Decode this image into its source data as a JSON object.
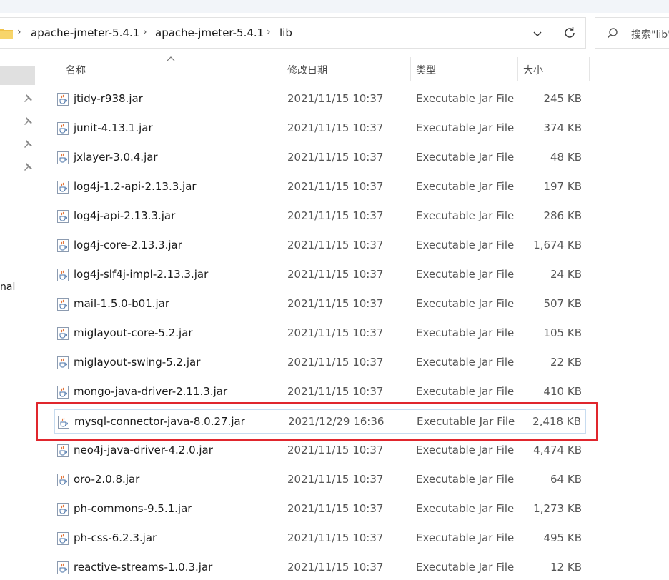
{
  "breadcrumb": {
    "items": [
      "apache-jmeter-5.4.1",
      "apache-jmeter-5.4.1",
      "lib"
    ]
  },
  "search": {
    "placeholder": "搜索\"lib\""
  },
  "nav": {
    "partial_label": "nal"
  },
  "columns": {
    "name": "名称",
    "modified": "修改日期",
    "type": "类型",
    "size": "大小"
  },
  "files": [
    {
      "name": "jtidy-r938.jar",
      "modified": "2021/11/15 10:37",
      "type": "Executable Jar File",
      "size": "245 KB"
    },
    {
      "name": "junit-4.13.1.jar",
      "modified": "2021/11/15 10:37",
      "type": "Executable Jar File",
      "size": "374 KB"
    },
    {
      "name": "jxlayer-3.0.4.jar",
      "modified": "2021/11/15 10:37",
      "type": "Executable Jar File",
      "size": "48 KB"
    },
    {
      "name": "log4j-1.2-api-2.13.3.jar",
      "modified": "2021/11/15 10:37",
      "type": "Executable Jar File",
      "size": "197 KB"
    },
    {
      "name": "log4j-api-2.13.3.jar",
      "modified": "2021/11/15 10:37",
      "type": "Executable Jar File",
      "size": "286 KB"
    },
    {
      "name": "log4j-core-2.13.3.jar",
      "modified": "2021/11/15 10:37",
      "type": "Executable Jar File",
      "size": "1,674 KB"
    },
    {
      "name": "log4j-slf4j-impl-2.13.3.jar",
      "modified": "2021/11/15 10:37",
      "type": "Executable Jar File",
      "size": "24 KB"
    },
    {
      "name": "mail-1.5.0-b01.jar",
      "modified": "2021/11/15 10:37",
      "type": "Executable Jar File",
      "size": "507 KB"
    },
    {
      "name": "miglayout-core-5.2.jar",
      "modified": "2021/11/15 10:37",
      "type": "Executable Jar File",
      "size": "105 KB"
    },
    {
      "name": "miglayout-swing-5.2.jar",
      "modified": "2021/11/15 10:37",
      "type": "Executable Jar File",
      "size": "22 KB"
    },
    {
      "name": "mongo-java-driver-2.11.3.jar",
      "modified": "2021/11/15 10:37",
      "type": "Executable Jar File",
      "size": "410 KB"
    },
    {
      "name": "mysql-connector-java-8.0.27.jar",
      "modified": "2021/12/29 16:36",
      "type": "Executable Jar File",
      "size": "2,418 KB",
      "highlighted": true
    },
    {
      "name": "neo4j-java-driver-4.2.0.jar",
      "modified": "2021/11/15 10:37",
      "type": "Executable Jar File",
      "size": "4,474 KB"
    },
    {
      "name": "oro-2.0.8.jar",
      "modified": "2021/11/15 10:37",
      "type": "Executable Jar File",
      "size": "64 KB"
    },
    {
      "name": "ph-commons-9.5.1.jar",
      "modified": "2021/11/15 10:37",
      "type": "Executable Jar File",
      "size": "1,273 KB"
    },
    {
      "name": "ph-css-6.2.3.jar",
      "modified": "2021/11/15 10:37",
      "type": "Executable Jar File",
      "size": "495 KB"
    },
    {
      "name": "reactive-streams-1.0.3.jar",
      "modified": "2021/11/15 10:37",
      "type": "Executable Jar File",
      "size": "12 KB"
    }
  ],
  "colors": {
    "highlight_border": "#e0262d",
    "selection_border": "#c7dcf0"
  },
  "icons": {
    "file": "java-jar-icon",
    "folder": "folder-icon",
    "pin": "pin-icon"
  }
}
